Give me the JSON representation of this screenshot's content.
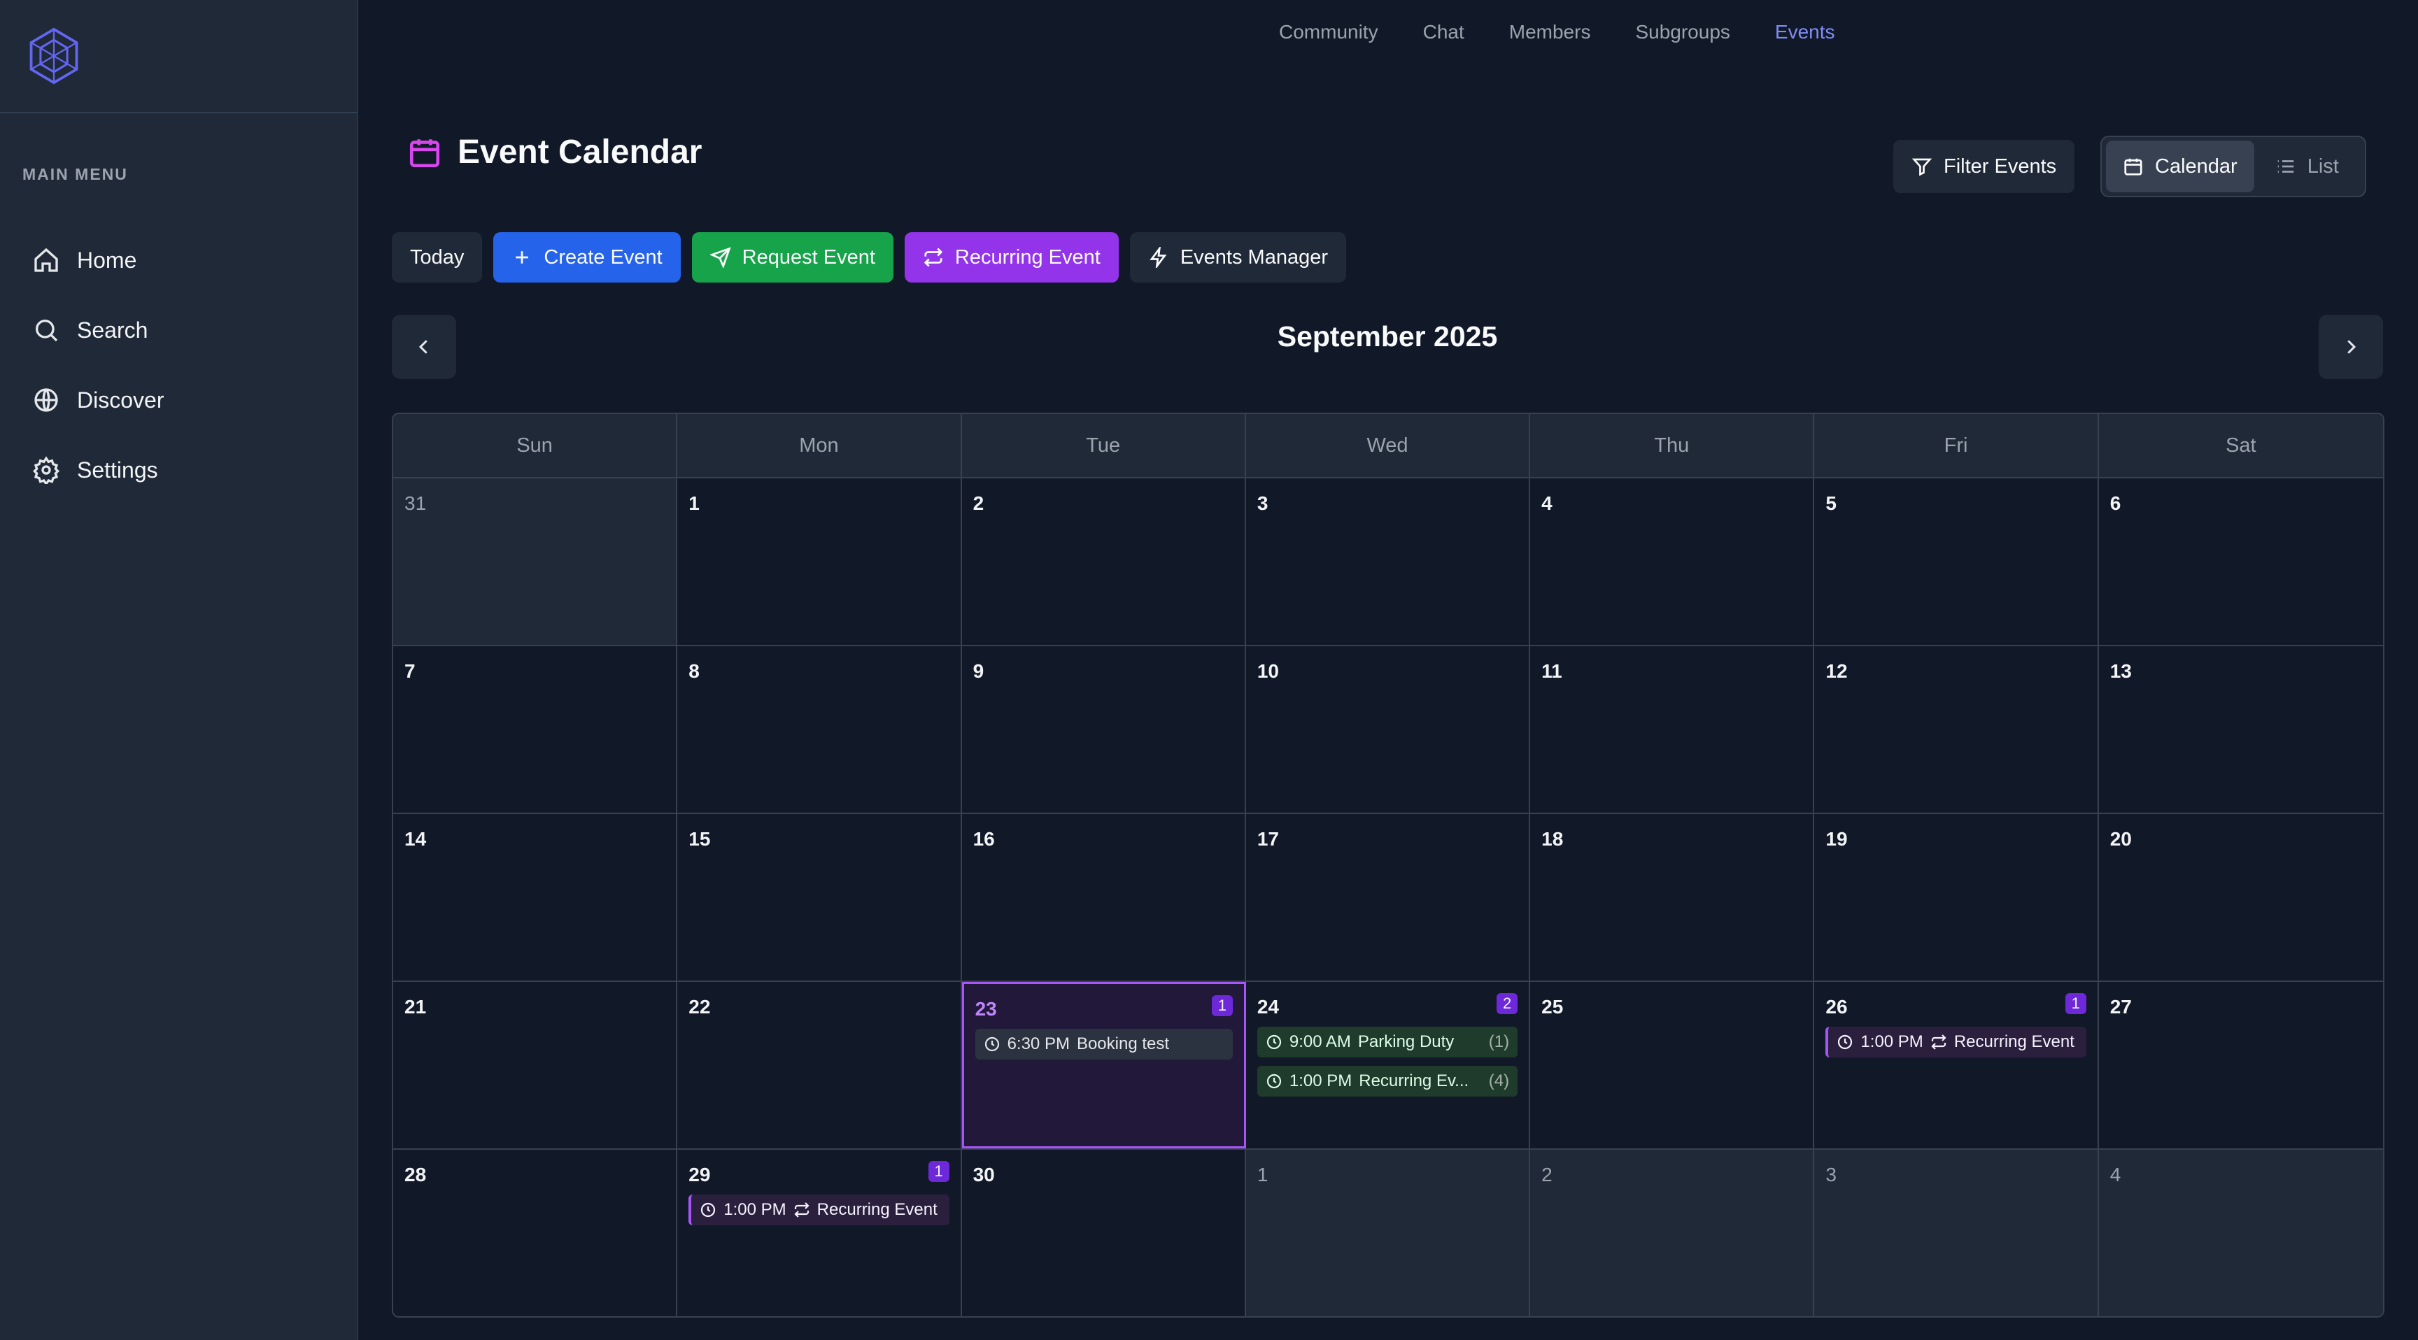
{
  "sidebar": {
    "menu_title": "MAIN MENU",
    "items": [
      {
        "label": "Home",
        "icon": "home-icon"
      },
      {
        "label": "Search",
        "icon": "search-icon"
      },
      {
        "label": "Discover",
        "icon": "globe-icon"
      },
      {
        "label": "Settings",
        "icon": "gear-icon"
      }
    ]
  },
  "topnav": [
    "Community",
    "Chat",
    "Members",
    "Subgroups",
    "Events"
  ],
  "page": {
    "title": "Event Calendar",
    "month": "September 2025"
  },
  "toolbar": {
    "filter": "Filter Events",
    "calendar": "Calendar",
    "list": "List",
    "today": "Today",
    "create": "Create Event",
    "request": "Request Event",
    "recurring": "Recurring Event",
    "manager": "Events Manager"
  },
  "weekdays": [
    "Sun",
    "Mon",
    "Tue",
    "Wed",
    "Thu",
    "Fri",
    "Sat"
  ],
  "days": [
    "31",
    "1",
    "2",
    "3",
    "4",
    "5",
    "6",
    "7",
    "8",
    "9",
    "10",
    "11",
    "12",
    "13",
    "14",
    "15",
    "16",
    "17",
    "18",
    "19",
    "20",
    "21",
    "22",
    "23",
    "24",
    "25",
    "26",
    "27",
    "28",
    "29",
    "30",
    "1",
    "2",
    "3",
    "4"
  ],
  "counts": {
    "d23": "1",
    "d24": "2",
    "d26": "1",
    "d29": "1"
  },
  "events": {
    "e23": {
      "time": "6:30 PM",
      "title": "Booking test"
    },
    "e24a": {
      "time": "9:00 AM",
      "title": "Parking Duty",
      "suffix": "(1)"
    },
    "e24b": {
      "time": "1:00 PM",
      "title": "Recurring Ev...",
      "suffix": "(4)"
    },
    "e26": {
      "time": "1:00 PM",
      "title": "Recurring Event"
    },
    "e29": {
      "time": "1:00 PM",
      "title": "Recurring Event"
    }
  },
  "colors": {
    "accent": "#818cf8",
    "today": "#a855f7",
    "create": "#2563eb",
    "request": "#16a34a",
    "recurring": "#9333ea"
  }
}
